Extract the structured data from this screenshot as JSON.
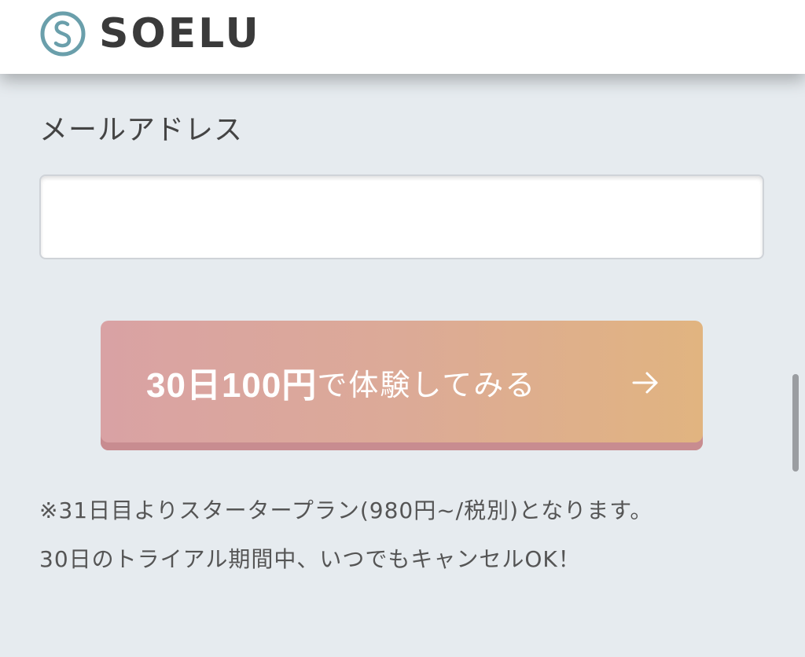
{
  "header": {
    "logo_text": "SOELU",
    "background": "#ffffff"
  },
  "form": {
    "email_label": "メールアドレス",
    "email_value": "",
    "email_placeholder": ""
  },
  "cta": {
    "strong_text": "30日100円",
    "normal_text": "で体験してみる",
    "icon": "arrow-right-icon",
    "gradient_start": "#d9a2a4",
    "gradient_end": "#e1b480"
  },
  "notes": {
    "line1": "※31日目よりスタータープラン(980円~/税別)となります。",
    "line2": "30日のトライアル期間中、いつでもキャンセルOK！"
  },
  "colors": {
    "page_background": "#e6ebef",
    "logo_mark": "#6a9fab",
    "text": "#444444"
  }
}
